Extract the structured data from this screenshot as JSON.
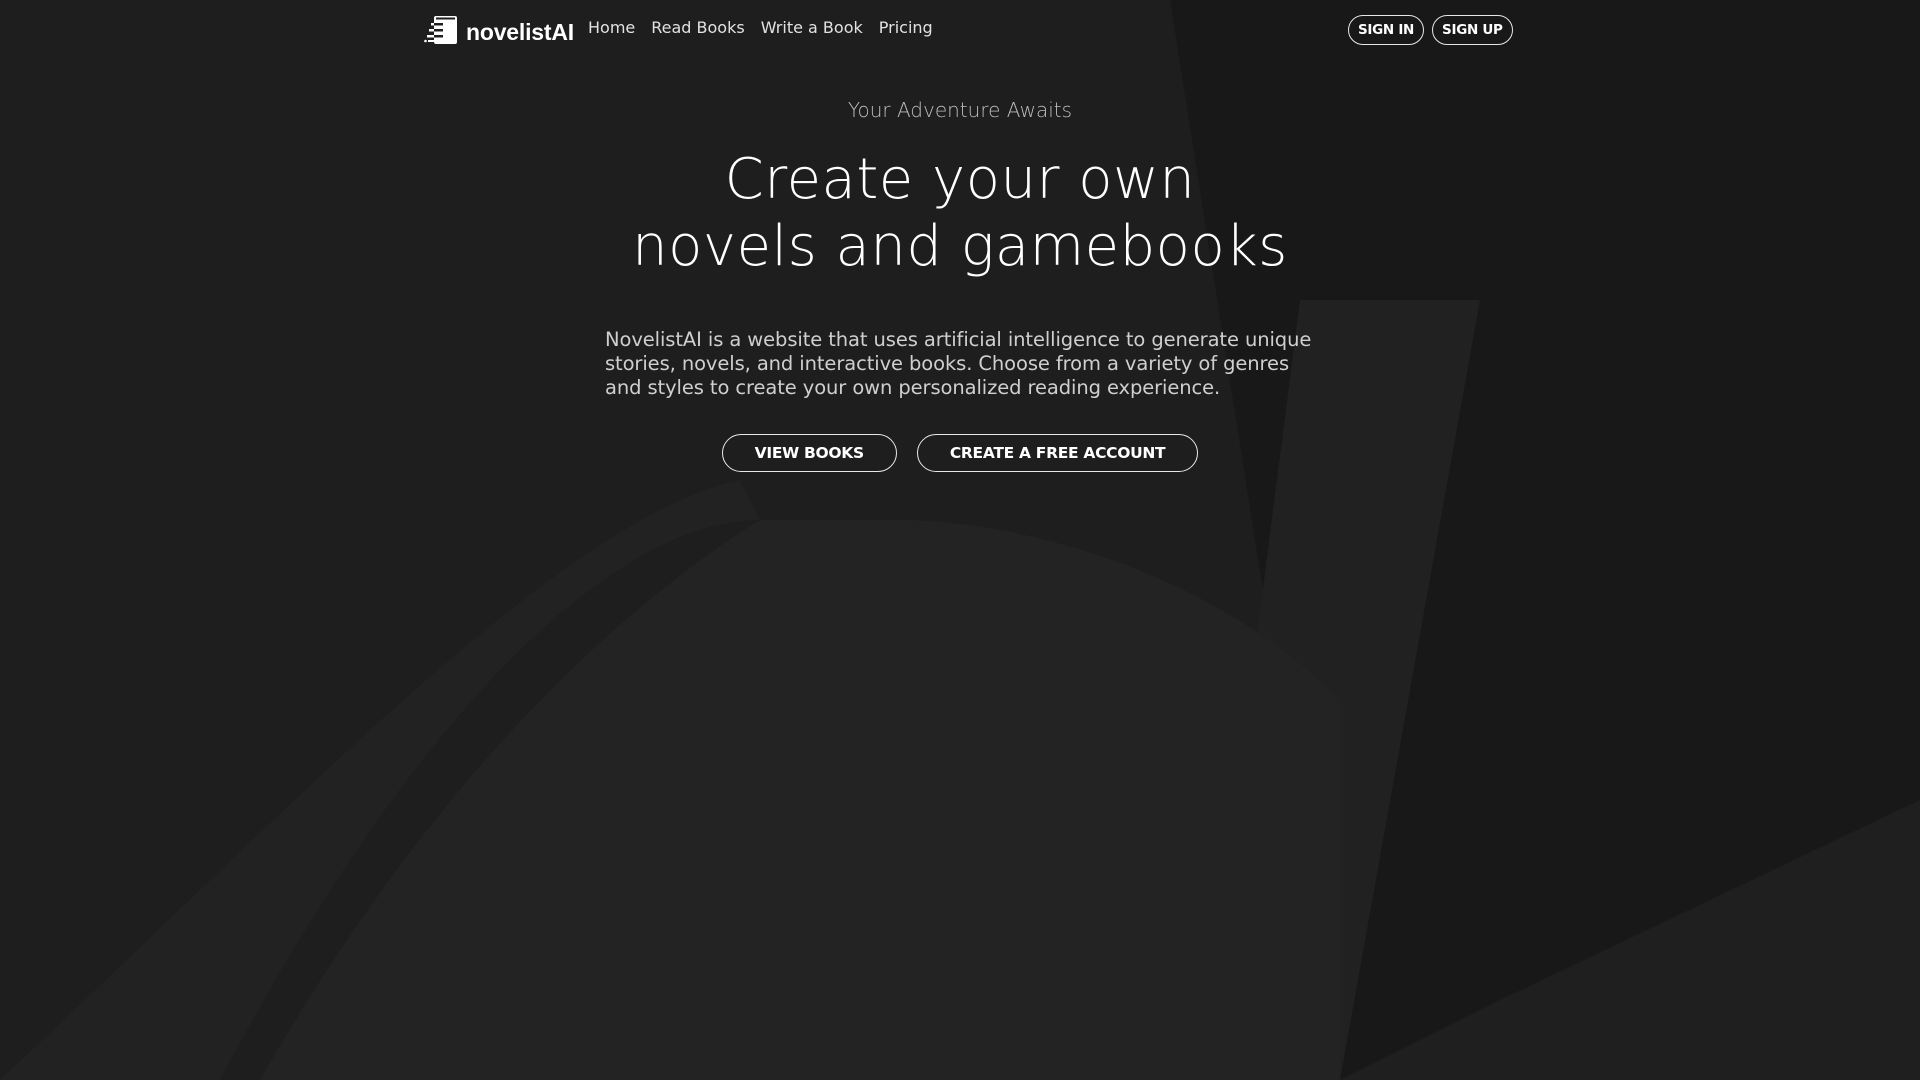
{
  "brand": {
    "name": "novelistAI",
    "logo_icon": "book-speed-icon"
  },
  "nav": {
    "links": [
      {
        "label": "Home"
      },
      {
        "label": "Read Books"
      },
      {
        "label": "Write a Book"
      },
      {
        "label": "Pricing"
      }
    ],
    "sign_in_label": "SIGN IN",
    "sign_up_label": "SIGN UP"
  },
  "hero": {
    "eyebrow": "Your Adventure Awaits",
    "headline_line1": "Create your own",
    "headline_line2": "novels and gamebooks",
    "description": "NovelistAI is a website that uses artificial intelligence to generate unique stories, novels, and interactive books. Choose from a variety of genres and styles to create your own personalized reading experience.",
    "primary_button": "VIEW BOOKS",
    "secondary_button": "CREATE A FREE ACCOUNT"
  },
  "theme": {
    "background": "#1d1d1d",
    "text": "#ffffff",
    "muted_text": "#bdbdbd",
    "button_border": "#e8e8e8"
  }
}
